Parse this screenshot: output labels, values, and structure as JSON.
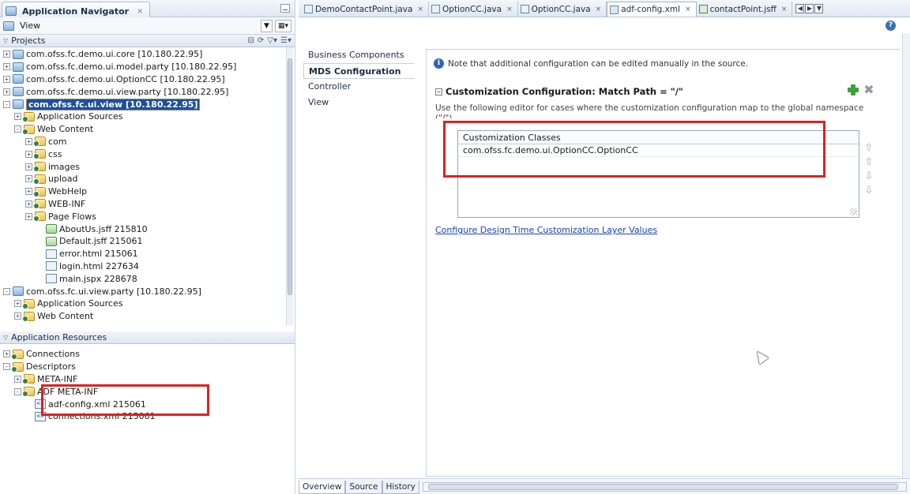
{
  "navigator": {
    "tab_title": "Application Navigator",
    "view_label": "View",
    "projects_header": "Projects",
    "projects": [
      {
        "label": "com.ofss.fc.demo.ui.core [10.180.22.95]",
        "indent": 0,
        "exp": "+",
        "icon": "proj"
      },
      {
        "label": "com.ofss.fc.demo.ui.model.party [10.180.22.95]",
        "indent": 0,
        "exp": "+",
        "icon": "proj"
      },
      {
        "label": "com.ofss.fc.demo.ui.OptionCC [10.180.22.95]",
        "indent": 0,
        "exp": "+",
        "icon": "proj"
      },
      {
        "label": "com.ofss.fc.demo.ui.view.party [10.180.22.95]",
        "indent": 0,
        "exp": "+",
        "icon": "proj"
      },
      {
        "label": "com.ofss.fc.ui.view [10.180.22.95]",
        "indent": 0,
        "exp": "-",
        "icon": "proj",
        "selected": true
      },
      {
        "label": "Application Sources",
        "indent": 1,
        "exp": "+",
        "icon": "folder"
      },
      {
        "label": "Web Content",
        "indent": 1,
        "exp": "-",
        "icon": "folder"
      },
      {
        "label": "com",
        "indent": 2,
        "exp": "+",
        "icon": "folder"
      },
      {
        "label": "css",
        "indent": 2,
        "exp": "+",
        "icon": "folder"
      },
      {
        "label": "images",
        "indent": 2,
        "exp": "+",
        "icon": "folder"
      },
      {
        "label": "upload",
        "indent": 2,
        "exp": "+",
        "icon": "folder"
      },
      {
        "label": "WebHelp",
        "indent": 2,
        "exp": "+",
        "icon": "folder"
      },
      {
        "label": "WEB-INF",
        "indent": 2,
        "exp": "+",
        "icon": "folder"
      },
      {
        "label": "Page Flows",
        "indent": 2,
        "exp": "+",
        "icon": "folder"
      },
      {
        "label": "AboutUs.jsff  215810",
        "indent": 3,
        "exp": "",
        "icon": "page"
      },
      {
        "label": "Default.jsff  215061",
        "indent": 3,
        "exp": "",
        "icon": "page"
      },
      {
        "label": "error.html  215061",
        "indent": 3,
        "exp": "",
        "icon": "file"
      },
      {
        "label": "login.html  227634",
        "indent": 3,
        "exp": "",
        "icon": "file"
      },
      {
        "label": "main.jspx  228678",
        "indent": 3,
        "exp": "",
        "icon": "file"
      },
      {
        "label": "com.ofss.fc.ui.view.party [10.180.22.95]",
        "indent": 0,
        "exp": "-",
        "icon": "proj"
      },
      {
        "label": "Application Sources",
        "indent": 1,
        "exp": "+",
        "icon": "folder"
      },
      {
        "label": "Web Content",
        "indent": 1,
        "exp": "+",
        "icon": "folder"
      }
    ],
    "resources_header": "Application Resources",
    "resources": [
      {
        "label": "Connections",
        "indent": 0,
        "exp": "+",
        "icon": "folder"
      },
      {
        "label": "Descriptors",
        "indent": 0,
        "exp": "-",
        "icon": "folder"
      },
      {
        "label": "META-INF",
        "indent": 1,
        "exp": "+",
        "icon": "folder"
      },
      {
        "label": "ADF META-INF",
        "indent": 1,
        "exp": "-",
        "icon": "folder"
      },
      {
        "label": "adf-config.xml  215061",
        "indent": 2,
        "exp": "",
        "icon": "xmlf"
      },
      {
        "label": "connections.xml  215061",
        "indent": 2,
        "exp": "",
        "icon": "xmlf"
      }
    ]
  },
  "editor": {
    "tabs": [
      {
        "label": "DemoContactPoint.java",
        "icon": "java",
        "active": false
      },
      {
        "label": "OptionCC.java",
        "icon": "java",
        "active": false
      },
      {
        "label": "OptionCC.java",
        "icon": "java",
        "active": false
      },
      {
        "label": "adf-config.xml",
        "icon": "xml",
        "active": true
      },
      {
        "label": "contactPoint.jsff",
        "icon": "jsff",
        "active": false
      }
    ],
    "side_nav": [
      "Business Components",
      "MDS Configuration",
      "Controller",
      "View"
    ],
    "side_nav_active": "MDS Configuration",
    "note": "Note that additional configuration can be edited manually in the source.",
    "section_title": "Customization Configuration: Match Path = \"/\"",
    "description": "Use the following editor for cases where the customization configuration map to the global namespace (\"/\").",
    "table_header": "Customization Classes",
    "table_rows": [
      "com.ofss.fc.demo.ui.OptionCC.OptionCC"
    ],
    "link": "Configure Design Time Customization Layer Values",
    "bottom_tabs": [
      "Overview",
      "Source",
      "History"
    ],
    "bottom_active": "Overview"
  },
  "colors": {
    "highlight_box": "#e02020",
    "selection": "#1f4f9b",
    "link": "#1a44b8"
  }
}
